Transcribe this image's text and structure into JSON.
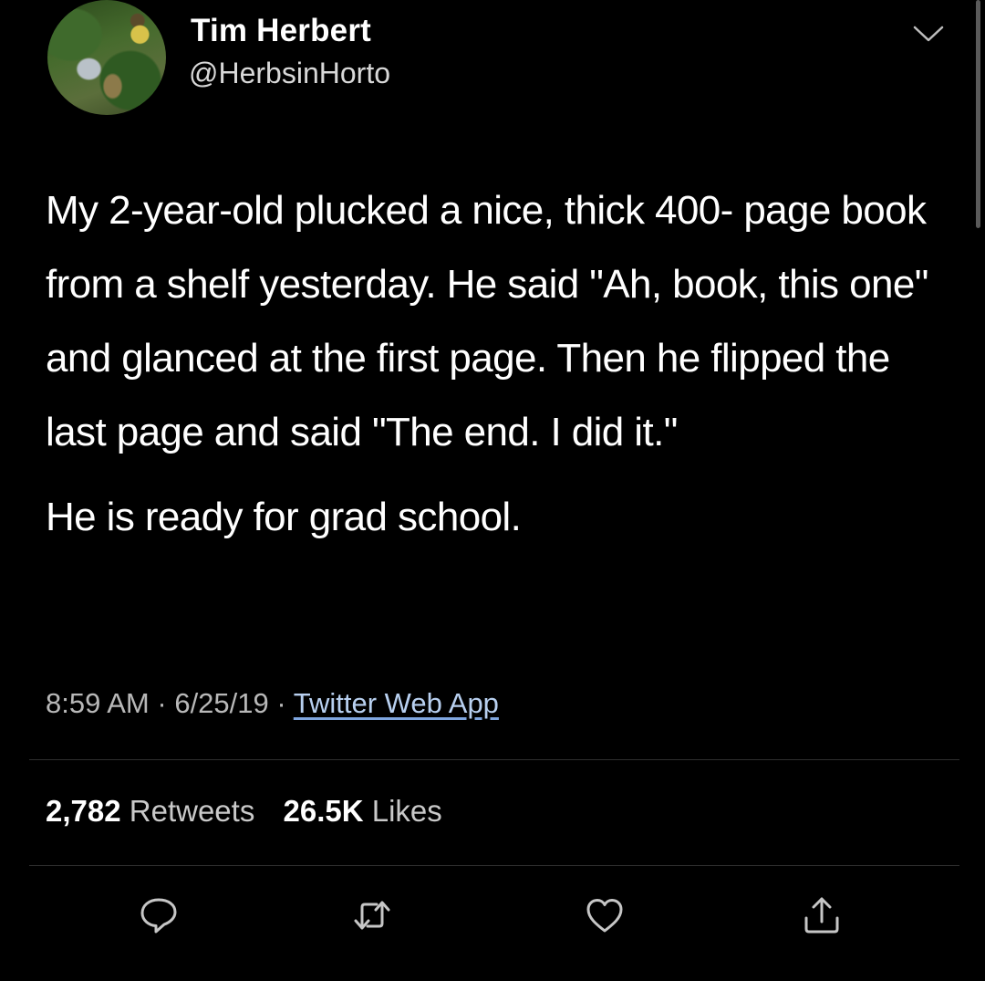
{
  "user": {
    "name": "Tim Herbert",
    "handle": "@HerbsinHorto"
  },
  "tweet": {
    "paragraph1": "My 2-year-old plucked a nice, thick 400- page book from a shelf yesterday. He said \"Ah, book, this one\" and glanced at the first page. Then he flipped the last page and said \"The end. I did it.\"",
    "paragraph2": "He is ready for grad school."
  },
  "meta": {
    "time": "8:59 AM",
    "date": "6/25/19",
    "separator": "·",
    "source": "Twitter Web App"
  },
  "stats": {
    "retweets_count": "2,782",
    "retweets_label": "Retweets",
    "likes_count": "26.5K",
    "likes_label": "Likes"
  },
  "icons": {
    "reply": "reply-icon",
    "retweet": "retweet-icon",
    "like": "heart-icon",
    "share": "share-icon",
    "menu": "chevron-down-icon"
  },
  "colors": {
    "background": "#000000",
    "text": "#ffffff",
    "secondary_text": "#b8b8b8",
    "link": "#b8d0f0"
  }
}
